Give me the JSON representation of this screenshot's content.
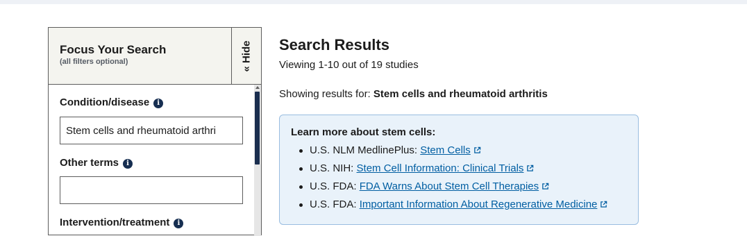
{
  "filters": {
    "title": "Focus Your Search",
    "subtitle": "(all filters optional)",
    "hide_label": "« Hide",
    "condition": {
      "label": "Condition/disease",
      "value": "Stem cells and rheumatoid arthri"
    },
    "other_terms": {
      "label": "Other terms",
      "value": ""
    },
    "intervention": {
      "label": "Intervention/treatment"
    }
  },
  "results": {
    "title": "Search Results",
    "viewing": "Viewing 1-10 out of 19 studies",
    "showing_prefix": "Showing results for:",
    "showing_query": "Stem cells and rheumatoid arthritis"
  },
  "learn_more": {
    "title": "Learn more about stem cells:",
    "items": [
      {
        "source": "U.S. NLM MedlinePlus:",
        "link": "Stem Cells"
      },
      {
        "source": "U.S. NIH:",
        "link": "Stem Cell Information: Clinical Trials"
      },
      {
        "source": "U.S. FDA:",
        "link": "FDA Warns About Stem Cell Therapies"
      },
      {
        "source": "U.S. FDA:",
        "link": "Important Information About Regenerative Medicine"
      }
    ]
  },
  "colors": {
    "link": "#005ea2",
    "info_icon": "#162e51",
    "callout_bg": "#e9f2fa"
  },
  "icons": {
    "info": "info-icon",
    "external": "external-link-icon"
  }
}
